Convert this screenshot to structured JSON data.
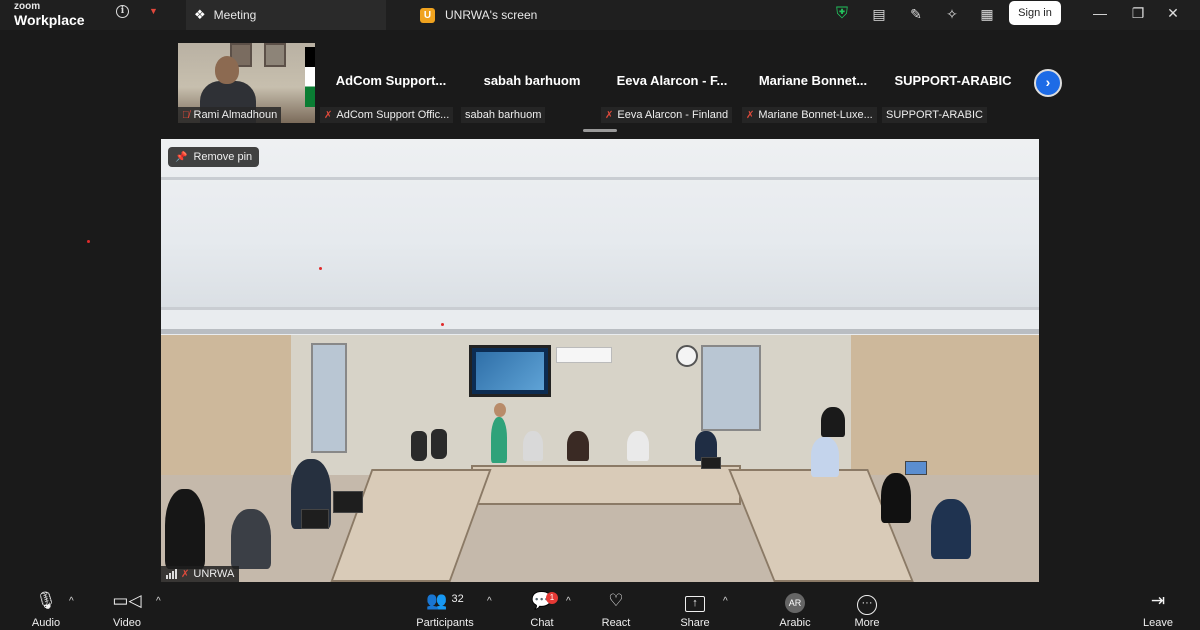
{
  "titlebar": {
    "brand_top": "zoom",
    "brand_bottom": "Workplace",
    "tab_meeting": "Meeting",
    "tab_screen_badge": "U",
    "tab_screen": "UNRWA's screen",
    "signin_label": "Sign in",
    "icons": [
      "info-icon",
      "chevron-down-icon",
      "shield-icon",
      "notes-icon",
      "annotate-icon",
      "sparkle-icon",
      "apps-icon",
      "minimize-icon",
      "restore-icon",
      "close-icon"
    ]
  },
  "strip": {
    "thumbs": [
      {
        "display_name": "",
        "label": "Rami Almadhoun",
        "muted": true
      },
      {
        "display_name": "AdCom  Support...",
        "label": "AdCom Support Offic...",
        "muted": true
      },
      {
        "display_name": "sabah barhuom",
        "label": "sabah barhuom",
        "muted": false
      },
      {
        "display_name": "Eeva Alarcon - F...",
        "label": "Eeva Alarcon - Finland",
        "muted": true
      },
      {
        "display_name": "Mariane  Bonnet...",
        "label": "Mariane Bonnet-Luxe...",
        "muted": true
      },
      {
        "display_name": "SUPPORT-ARABIC",
        "label": "SUPPORT-ARABIC",
        "muted": false
      }
    ]
  },
  "main": {
    "remove_pin": "Remove pin",
    "video_label": "UNRWA"
  },
  "toolbar": {
    "audio": "Audio",
    "video": "Video",
    "participants": "Participants",
    "participants_count": "32",
    "chat": "Chat",
    "chat_badge": "1",
    "react": "React",
    "share": "Share",
    "language": "Arabic",
    "language_code": "AR",
    "more": "More",
    "leave": "Leave"
  },
  "colors": {
    "accent_blue": "#1d6be6",
    "muted_red": "#e04a3b",
    "secure_green": "#22c55e",
    "badge_orange": "#f0a31f"
  }
}
